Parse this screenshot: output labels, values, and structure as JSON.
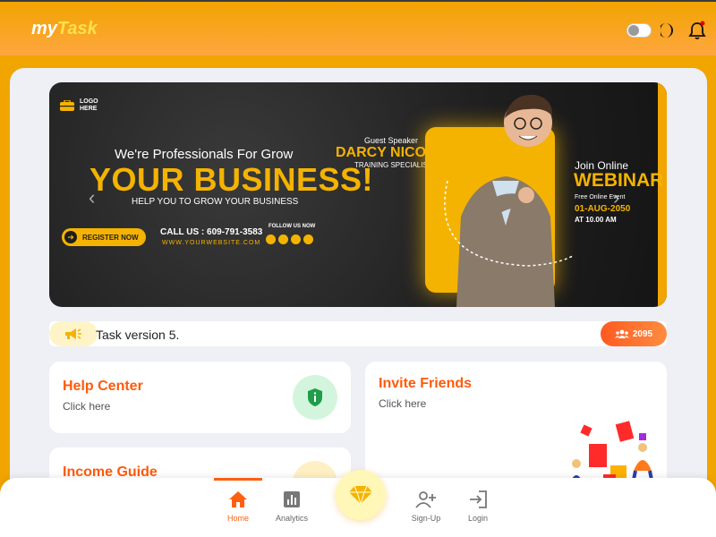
{
  "app": {
    "name_part1": "my",
    "name_part2": "Task"
  },
  "colors": {
    "primary": "#f0a500",
    "accent": "#ff5a0a",
    "banner_yellow": "#f5b301"
  },
  "header": {
    "icons": [
      "theme-toggle",
      "moon-icon",
      "bell-icon"
    ]
  },
  "banner": {
    "logo_line1": "LOGO",
    "logo_line2": "HERE",
    "tagline": "We're Professionals For Grow",
    "headline": "YOUR BUSINESS!",
    "subline": "HELP YOU TO GROW YOUR BUSINESS",
    "register_label": "REGISTER NOW",
    "call": "CALL US : 609-791-3583",
    "website": "WWW.YOURWEBSITE.COM",
    "follow": "FOLLOW US NOW",
    "guest_label": "Guest Speaker",
    "speaker_name": "DARCY NICOLL",
    "speaker_role": "TRAINING SPECIALIST",
    "join": "Join Online",
    "webinar": "WEBINAR",
    "free_event": "Free Online Event",
    "date": "01-AUG-2050",
    "time": "AT 10.00 AM"
  },
  "announcement": {
    "text": "Task version 5.",
    "count": "2095"
  },
  "cards": {
    "help": {
      "title": "Help Center",
      "subtitle": "Click here"
    },
    "invite": {
      "title": "Invite Friends",
      "subtitle": "Click here"
    },
    "income": {
      "title": "Income Guide"
    }
  },
  "nav": {
    "home": "Home",
    "analytics": "Analytics",
    "signup": "Sign-Up",
    "login": "Login"
  }
}
